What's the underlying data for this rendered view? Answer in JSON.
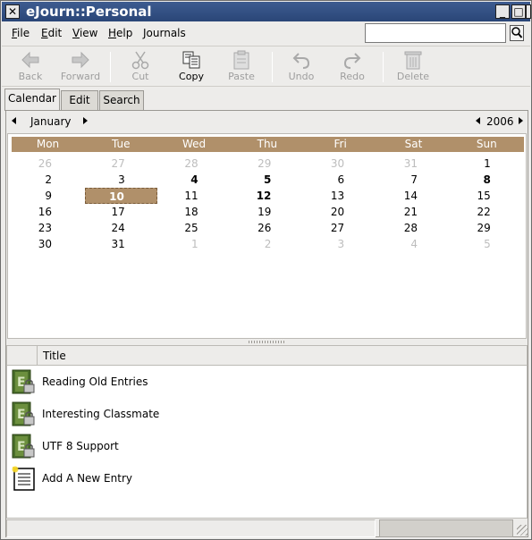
{
  "window": {
    "title": "eJourn::Personal",
    "close_glyph": "✕",
    "minimize_glyph": "_",
    "maximize_glyph": "□",
    "close2_glyph": "✕"
  },
  "menu": {
    "file": {
      "u": "F",
      "rest": "ile"
    },
    "edit": {
      "u": "E",
      "rest": "dit"
    },
    "view": {
      "u": "V",
      "rest": "iew"
    },
    "help": {
      "u": "H",
      "rest": "elp"
    },
    "journals": "Journals"
  },
  "search": {
    "value": "",
    "placeholder": ""
  },
  "toolbar": {
    "back": "Back",
    "forward": "Forward",
    "cut": "Cut",
    "copy": "Copy",
    "paste": "Paste",
    "undo": "Undo",
    "redo": "Redo",
    "delete": "Delete"
  },
  "tabs": [
    "Calendar",
    "Edit",
    "Search"
  ],
  "calendar": {
    "month": "January",
    "year": "2006",
    "weekdays": [
      "Mon",
      "Tue",
      "Wed",
      "Thu",
      "Fri",
      "Sat",
      "Sun"
    ],
    "weeks": [
      [
        "26",
        "27",
        "28",
        "29",
        "30",
        "31",
        "1"
      ],
      [
        "2",
        "3",
        "4",
        "5",
        "6",
        "7",
        "8"
      ],
      [
        "9",
        "10",
        "11",
        "12",
        "13",
        "14",
        "15"
      ],
      [
        "16",
        "17",
        "18",
        "19",
        "20",
        "21",
        "22"
      ],
      [
        "23",
        "24",
        "25",
        "26",
        "27",
        "28",
        "29"
      ],
      [
        "30",
        "31",
        "1",
        "2",
        "3",
        "4",
        "5"
      ]
    ],
    "selected_day": "10",
    "bold_days": [
      "4",
      "5",
      "8",
      "10",
      "12"
    ],
    "colors": {
      "header": "#b0906a",
      "selected": "#b0906a",
      "other_month": "#bdbdbd"
    }
  },
  "entries": {
    "column_title": "Title",
    "items": [
      {
        "title": "Reading Old Entries",
        "icon": "locked-entry-icon"
      },
      {
        "title": "Interesting Classmate",
        "icon": "locked-entry-icon"
      },
      {
        "title": "UTF 8 Support",
        "icon": "locked-entry-icon"
      },
      {
        "title": "Add A New Entry",
        "icon": "new-entry-icon"
      }
    ]
  }
}
